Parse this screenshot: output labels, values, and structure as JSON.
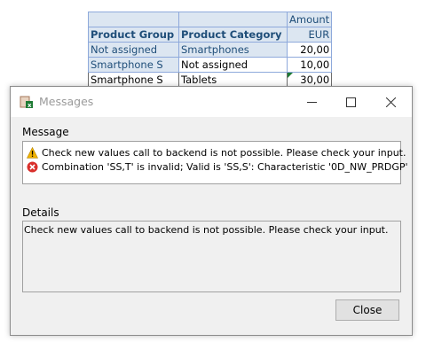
{
  "spreadsheet": {
    "header_row1": [
      "",
      "",
      "Amount"
    ],
    "header_row2": [
      "Product Group",
      "Product Category",
      "EUR"
    ],
    "rows": [
      [
        "Not assigned",
        "Smartphones",
        "20,00"
      ],
      [
        "Smartphone S",
        "Not assigned",
        "10,00"
      ],
      [
        "Smartphone S",
        "Tablets",
        "30,00"
      ]
    ]
  },
  "dialog": {
    "title": "Messages",
    "message_section_label": "Message",
    "messages": [
      {
        "icon": "warning-icon",
        "text": "Check new values call to backend is not possible. Please check your input."
      },
      {
        "icon": "error-icon",
        "text": "Combination 'SS,T' is invalid; Valid is 'SS,S': Characteristic '0D_NW_PRDGP'"
      }
    ],
    "details_section_label": "Details",
    "details_text": "Check new values call to backend is not possible. Please check your input.",
    "close_label": "Close"
  },
  "colors": {
    "header_fill": "#dce6f1",
    "header_text": "#1f4e79",
    "grid_border": "#8ea9db",
    "dialog_bg": "#f0f0f0",
    "warning": "#f2b300",
    "error": "#d9302c"
  }
}
